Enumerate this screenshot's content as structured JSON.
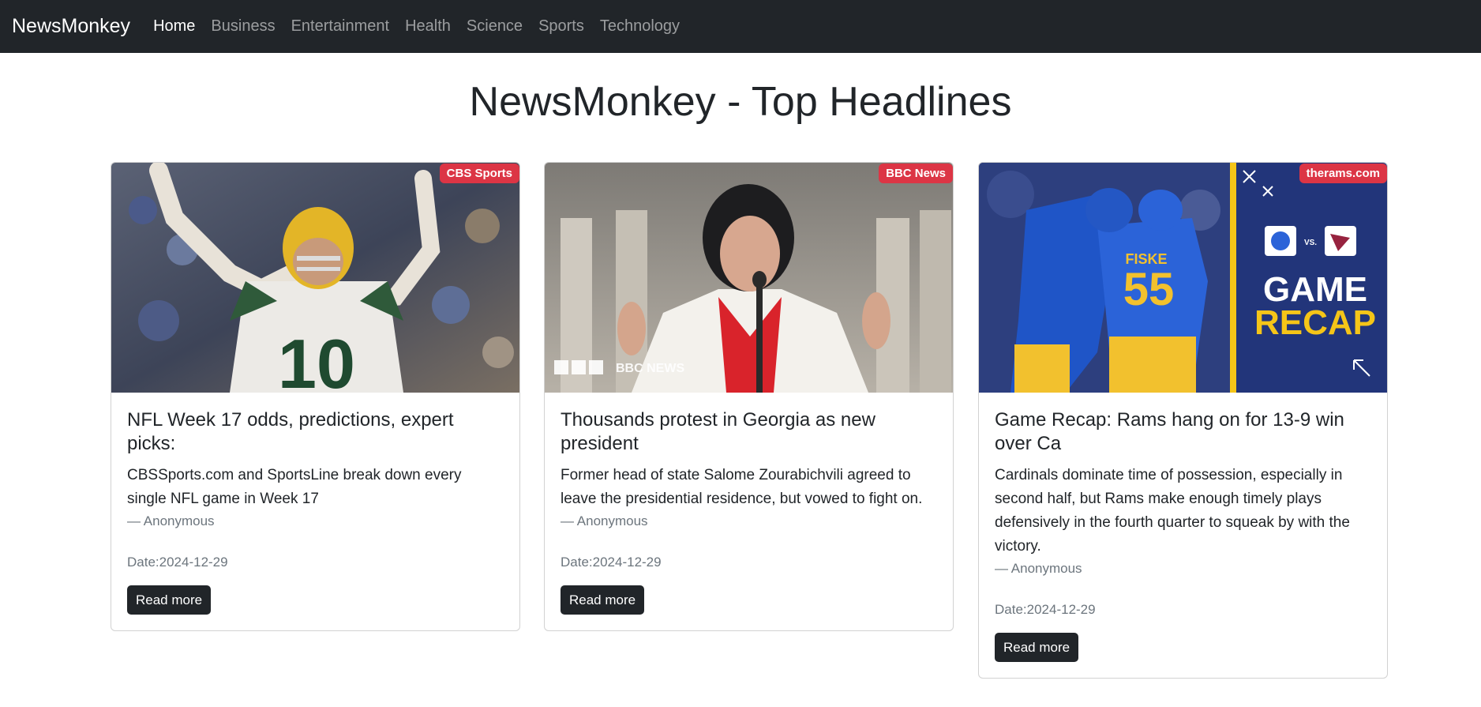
{
  "navbar": {
    "brand": "NewsMonkey",
    "links": [
      "Home",
      "Business",
      "Entertainment",
      "Health",
      "Science",
      "Sports",
      "Technology"
    ]
  },
  "page_title": "NewsMonkey - Top Headlines",
  "colors": {
    "navbar": "#212529",
    "badge": "#dc3545",
    "button": "#212529"
  },
  "articles": [
    {
      "source": "CBS Sports",
      "title": "NFL Week 17 odds, predictions, expert picks:",
      "description": "CBSSports.com and SportsLine break down every single NFL game in Week 17",
      "author": "— Anonymous",
      "date": "Date:2024-12-29",
      "button": "Read more",
      "image": {
        "jersey_number": "10"
      }
    },
    {
      "source": "BBC News",
      "title": "Thousands protest in Georgia as new president",
      "description": "Former head of state Salome Zourabichvili agreed to leave the presidential residence, but vowed to fight on.",
      "author": "— Anonymous",
      "date": "Date:2024-12-29",
      "button": "Read more",
      "image": {
        "watermark": "BBC NEWS"
      }
    },
    {
      "source": "therams.com",
      "title": "Game Recap: Rams hang on for 13-9 win over Ca",
      "description": "Cardinals dominate time of possession, especially in second half, but Rams make enough timely plays defensively in the fourth quarter to squeak by with the victory.",
      "author": "— Anonymous",
      "date": "Date:2024-12-29",
      "button": "Read more",
      "image": {
        "line1": "GAME",
        "line2": "RECAP",
        "jersey_name": "FISKE",
        "jersey_number": "55",
        "vs": "VS."
      }
    }
  ]
}
